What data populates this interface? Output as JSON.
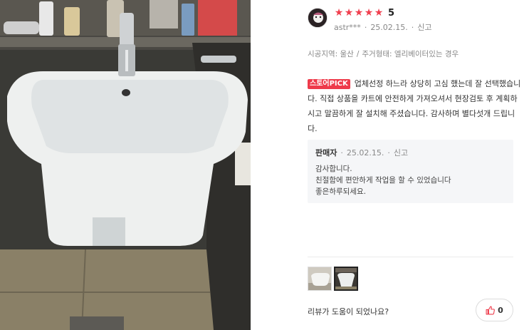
{
  "review": {
    "rating_stars": 5,
    "score": "5",
    "author": "astr***",
    "date": "25.02.15.",
    "report": "신고",
    "attributes": {
      "region": "시공지역: 울산",
      "housing": "주거형태: 엘리베이터있는 경우",
      "separator": "/"
    },
    "pick_badge": "스토어PICK",
    "text": "업체선정 하느라 상당히 고심 했는데 잘 선택했습니다. 직접 상품을 카트에 안전하게 가져오셔서 현장검토 후 계획하시고 말끔하게 잘 설치해 주셨습니다. 감사하며 별다섯개 드립니다.",
    "seller_reply": {
      "seller": "판매자",
      "date": "25.02.15.",
      "report": "신고",
      "line1": "감사합니다.",
      "line2": "친절함에 편안하게 작업을 할 수 있었습니다",
      "line3": "좋은하루되세요."
    },
    "helpful_question": "리뷰가 도움이 되었나요?",
    "like_count": "0",
    "dot": "·"
  },
  "colors": {
    "star": "#f0404f",
    "pick_badge": "#ee3a4a"
  },
  "icons": {
    "star": "★",
    "like": "thumbs-up-icon"
  }
}
